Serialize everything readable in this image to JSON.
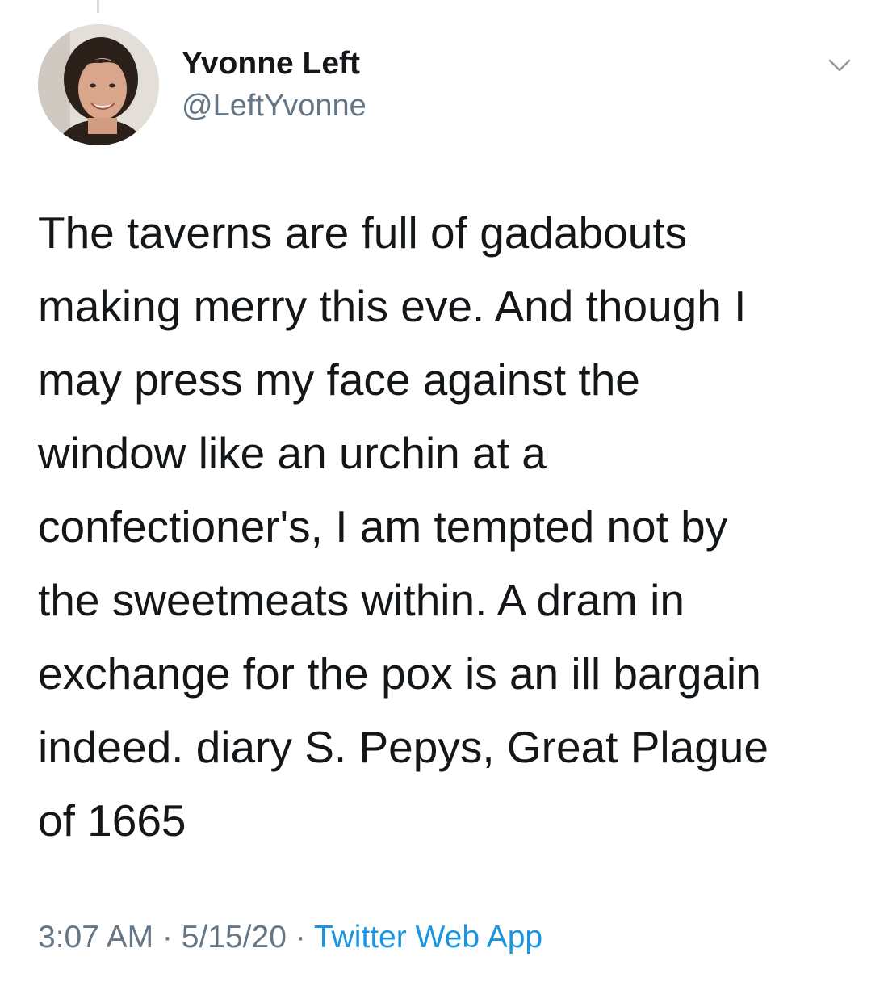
{
  "author": {
    "display_name": "Yvonne Left",
    "handle": "@LeftYvonne",
    "avatar_icon": "profile-photo"
  },
  "tweet": {
    "text": "The taverns are full of gadabouts\nmaking merry this eve. And though I\nmay press my face against the\nwindow like an urchin at a\nconfectioner's, I am tempted not by\nthe sweetmeats within. A dram in\nexchange for the pox is an ill bargain\nindeed. diary S. Pepys, Great Plague\nof 1665"
  },
  "meta": {
    "time": "3:07 AM",
    "separator": " · ",
    "date": "5/15/20",
    "source": "Twitter Web App"
  },
  "colors": {
    "text": "#14171a",
    "secondary": "#657786",
    "link": "#1b95e0"
  },
  "icons": {
    "more": "chevron-down-icon"
  }
}
